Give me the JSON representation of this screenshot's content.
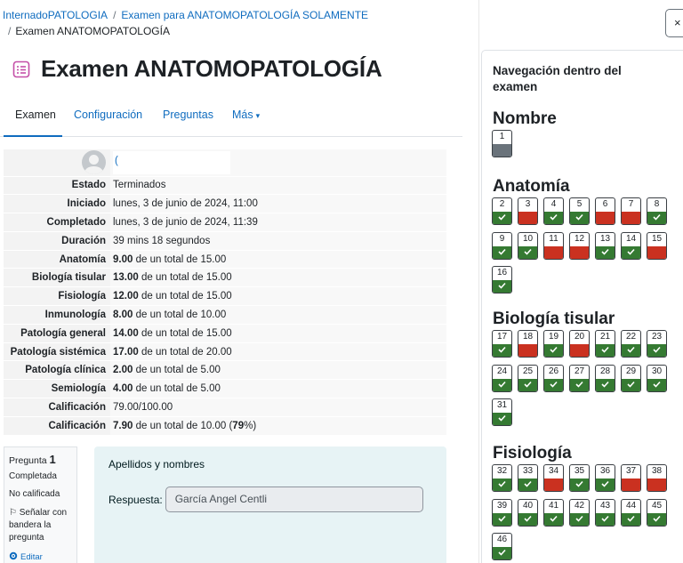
{
  "breadcrumb": {
    "course": "InternadoPATOLOGIA",
    "sep": "/",
    "quiz_section": "Examen para ANATOMOPATOLOGÍA SOLAMENTE",
    "current": "Examen ANATOMOPATOLOGÍA"
  },
  "page": {
    "title": "Examen ANATOMOPATOLOGÍA"
  },
  "tabs": [
    {
      "label": "Examen"
    },
    {
      "label": "Configuración"
    },
    {
      "label": "Preguntas"
    },
    {
      "label": "Más"
    }
  ],
  "summary": {
    "user_initial": "(",
    "rows": [
      {
        "label": "Estado",
        "value": "Terminados"
      },
      {
        "label": "Iniciado",
        "value": "lunes, 3 de junio de 2024, 11:00"
      },
      {
        "label": "Completado",
        "value": "lunes, 3 de junio de 2024, 11:39"
      },
      {
        "label": "Duración",
        "value": "39 mins 18 segundos"
      },
      {
        "label": "Anatomía",
        "score": "9.00",
        "rest": "de un total de 15.00"
      },
      {
        "label": "Biología tisular",
        "score": "13.00",
        "rest": "de un total de 15.00"
      },
      {
        "label": "Fisiología",
        "score": "12.00",
        "rest": "de un total de 15.00"
      },
      {
        "label": "Inmunología",
        "score": "8.00",
        "rest": "de un total de 10.00"
      },
      {
        "label": "Patología general",
        "score": "14.00",
        "rest": "de un total de 15.00"
      },
      {
        "label": "Patología sistémica",
        "score": "17.00",
        "rest": "de un total de 20.00"
      },
      {
        "label": "Patología clínica",
        "score": "2.00",
        "rest": "de un total de 5.00"
      },
      {
        "label": "Semiología",
        "score": "4.00",
        "rest": "de un total de 5.00"
      },
      {
        "label": "Calificación",
        "value": "79.00/100.00"
      },
      {
        "label": "Calificación",
        "score": "7.90",
        "rest": "de un total de 10.00 (",
        "pct": "79",
        "tail": "%)"
      }
    ]
  },
  "question": {
    "label": "Pregunta",
    "number": "1",
    "state": "Completada",
    "grade": "No calificada",
    "flag_label": "Señalar con bandera la pregunta",
    "edit_label": "Editar",
    "text": "Apellidos y nombres",
    "answer_label": "Respuesta:",
    "answer_value": "García Angel Centli"
  },
  "drawer": {
    "close_symbol": "×",
    "heading": "Navegación dentro del examen",
    "sections": [
      {
        "title": "Nombre",
        "items": [
          {
            "n": "1",
            "state": "notgraded"
          }
        ]
      },
      {
        "title": "Anatomía",
        "items": [
          {
            "n": "2",
            "state": "correct"
          },
          {
            "n": "3",
            "state": "incorrect"
          },
          {
            "n": "4",
            "state": "correct"
          },
          {
            "n": "5",
            "state": "correct"
          },
          {
            "n": "6",
            "state": "incorrect"
          },
          {
            "n": "7",
            "state": "incorrect"
          },
          {
            "n": "8",
            "state": "correct"
          },
          {
            "n": "9",
            "state": "correct"
          },
          {
            "n": "10",
            "state": "correct"
          },
          {
            "n": "11",
            "state": "incorrect"
          },
          {
            "n": "12",
            "state": "incorrect"
          },
          {
            "n": "13",
            "state": "correct"
          },
          {
            "n": "14",
            "state": "correct"
          },
          {
            "n": "15",
            "state": "incorrect"
          },
          {
            "n": "16",
            "state": "correct"
          }
        ]
      },
      {
        "title": "Biología tisular",
        "items": [
          {
            "n": "17",
            "state": "correct"
          },
          {
            "n": "18",
            "state": "incorrect"
          },
          {
            "n": "19",
            "state": "correct"
          },
          {
            "n": "20",
            "state": "incorrect"
          },
          {
            "n": "21",
            "state": "correct"
          },
          {
            "n": "22",
            "state": "correct"
          },
          {
            "n": "23",
            "state": "correct"
          },
          {
            "n": "24",
            "state": "correct"
          },
          {
            "n": "25",
            "state": "correct"
          },
          {
            "n": "26",
            "state": "correct"
          },
          {
            "n": "27",
            "state": "correct"
          },
          {
            "n": "28",
            "state": "correct"
          },
          {
            "n": "29",
            "state": "correct"
          },
          {
            "n": "30",
            "state": "correct"
          },
          {
            "n": "31",
            "state": "correct"
          }
        ]
      },
      {
        "title": "Fisiología",
        "items": [
          {
            "n": "32",
            "state": "correct"
          },
          {
            "n": "33",
            "state": "correct"
          },
          {
            "n": "34",
            "state": "incorrect"
          },
          {
            "n": "35",
            "state": "correct"
          },
          {
            "n": "36",
            "state": "correct"
          },
          {
            "n": "37",
            "state": "incorrect"
          },
          {
            "n": "38",
            "state": "incorrect"
          },
          {
            "n": "39",
            "state": "correct"
          },
          {
            "n": "40",
            "state": "correct"
          },
          {
            "n": "41",
            "state": "correct"
          },
          {
            "n": "42",
            "state": "correct"
          },
          {
            "n": "43",
            "state": "correct"
          },
          {
            "n": "44",
            "state": "correct"
          },
          {
            "n": "45",
            "state": "correct"
          },
          {
            "n": "46",
            "state": "correct"
          }
        ]
      }
    ]
  },
  "colors": {
    "link": "#0f6cbf",
    "correct": "#357a32",
    "incorrect": "#ca3120",
    "not_graded": "#6a737b",
    "question_bg": "#e7f3f5",
    "quiz_icon": "#c44fa8"
  },
  "icons": [
    "quiz-icon",
    "chevron-down-icon",
    "flag-icon",
    "gear-icon",
    "check-icon",
    "close-icon",
    "avatar"
  ]
}
